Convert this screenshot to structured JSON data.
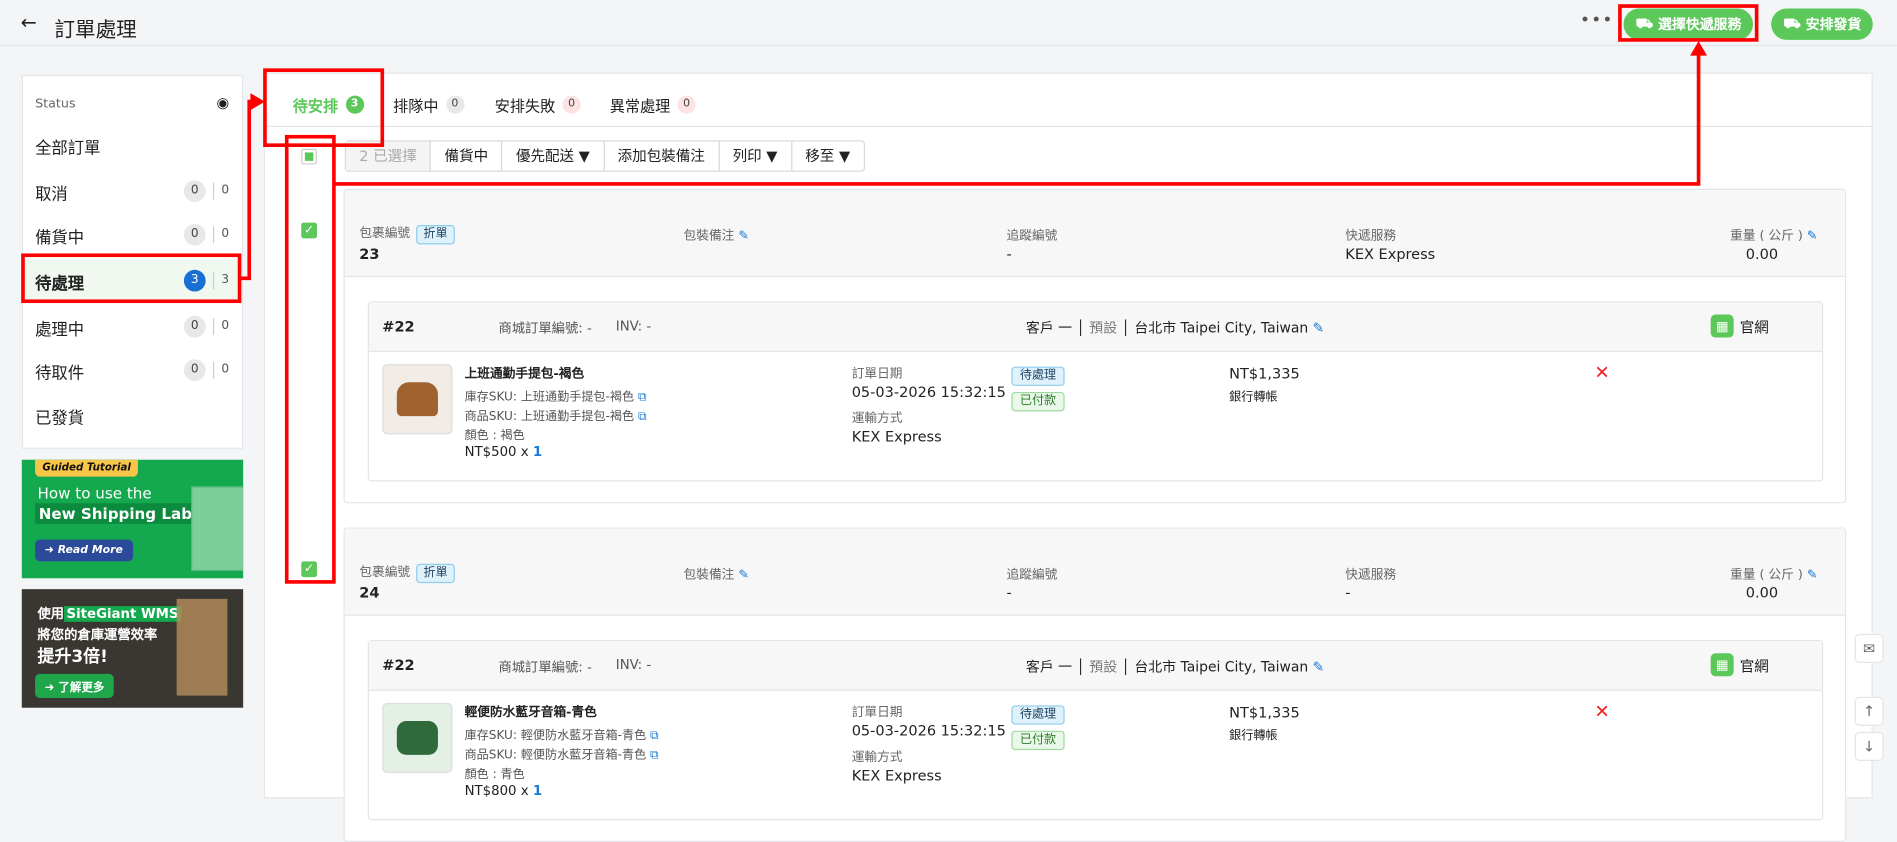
{
  "header": {
    "title": "訂單處理",
    "more": "•••",
    "select_courier": "選擇快遞服務",
    "arrange_shipment": "安排發貨"
  },
  "sidebar": {
    "status_label": "Status",
    "items": [
      {
        "label": "全部訂單"
      },
      {
        "label": "取消",
        "count": "0",
        "total": "0"
      },
      {
        "label": "備貨中",
        "count": "0",
        "total": "0"
      },
      {
        "label": "待處理",
        "count": "3",
        "total": "3",
        "active": true
      },
      {
        "label": "處理中",
        "count": "0",
        "total": "0"
      },
      {
        "label": "待取件",
        "count": "0",
        "total": "0"
      },
      {
        "label": "已發貨"
      }
    ]
  },
  "banners": [
    {
      "tag": "Guided Tutorial",
      "line1": "How to use the",
      "line2": "New Shipping Label?",
      "button": "Read More"
    },
    {
      "line1a": "使用",
      "line1b": "SiteGiant WMS",
      "line2": "將您的倉庫運營效率",
      "line3": "提升3倍!",
      "button": "了解更多"
    }
  ],
  "tabs": [
    {
      "label": "待安排",
      "count": "3"
    },
    {
      "label": "排隊中",
      "count": "0"
    },
    {
      "label": "安排失敗",
      "count": "0"
    },
    {
      "label": "異常處理",
      "count": "0"
    }
  ],
  "toolbar": {
    "selected": "2 已選擇",
    "b1": "備貨中",
    "b2": "優先配送",
    "b3": "添加包裝備注",
    "b4": "列印",
    "b5": "移至"
  },
  "labels": {
    "pkg_no": "包裹編號",
    "split": "折單",
    "pack_note": "包裝備注",
    "tracking": "追蹤編號",
    "courier": "快遞服務",
    "weight": "重量 ( 公斤 )",
    "mall_no": "商城訂單編號: -",
    "inv": "INV: -",
    "order_date": "訂單日期",
    "shipping": "運輸方式",
    "sku_stock": "庫存SKU:",
    "sku_prod": "商品SKU:",
    "color": "顏色 :",
    "channel": "官網",
    "customer": "客戶 一",
    "default": "預設",
    "address": "台北市 Taipei City, Taiwan"
  },
  "packages": [
    {
      "no": "23",
      "tracking": "-",
      "courier": "KEX Express",
      "weight": "0.00",
      "order": "#22",
      "product": "上班通勤手提包-褐色",
      "sku": "上班通勤手提包-褐色",
      "color": "褐色",
      "price": "NT$500",
      "qty_x": "x",
      "qty": "1",
      "date": "05-03-2026 15:32:15",
      "ship": "KEX Express",
      "status": "待處理",
      "paid": "已付款",
      "total": "NT$1,335",
      "pay": "銀行轉帳"
    },
    {
      "no": "24",
      "tracking": "-",
      "courier": "-",
      "weight": "0.00",
      "order": "#22",
      "product": "輕便防水藍牙音箱-青色",
      "sku": "輕便防水藍牙音箱-青色",
      "color": "青色",
      "price": "NT$800",
      "qty_x": "x",
      "qty": "1",
      "date": "05-03-2026 15:32:15",
      "ship": "KEX Express",
      "status": "待處理",
      "paid": "已付款",
      "total": "NT$1,335",
      "pay": "銀行轉帳"
    }
  ]
}
